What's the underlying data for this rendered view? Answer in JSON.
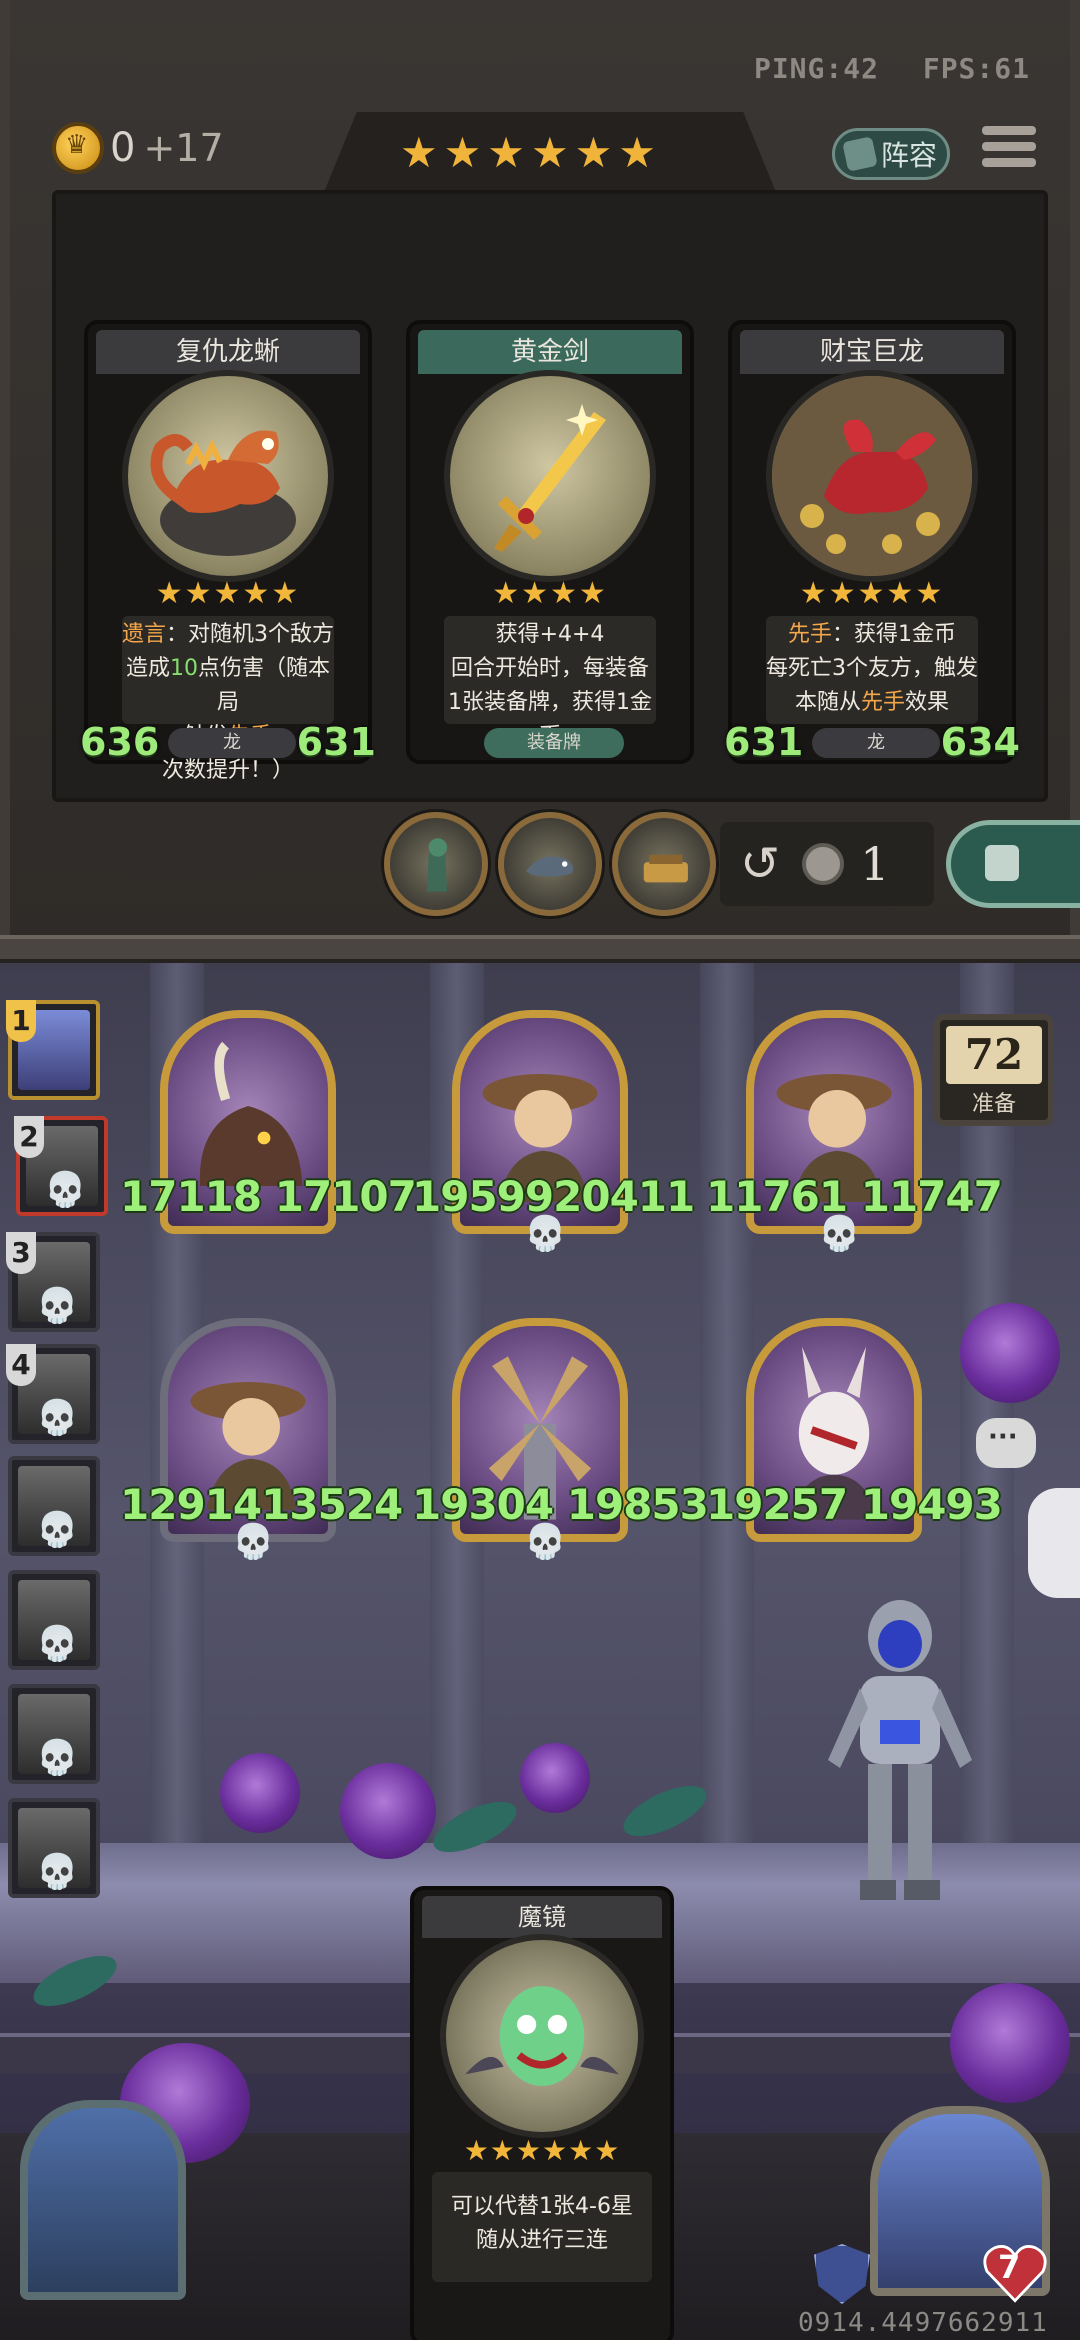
{
  "hud": {
    "ping": "PING:42",
    "fps": "FPS:61"
  },
  "gold": {
    "amount": "0",
    "income": "+17"
  },
  "tavern": {
    "stars": "★★★★★★"
  },
  "lineup_button": {
    "label": "阵容"
  },
  "shop_cards": [
    {
      "name": "复仇龙蜥",
      "stars": "★★★★★",
      "text_parts": [
        {
          "t": "遗言",
          "c": "orange"
        },
        {
          "t": "：对随机3个敌方\n造成",
          "c": ""
        },
        {
          "t": "10",
          "c": "green"
        },
        {
          "t": "点伤害（随本局\n触发",
          "c": ""
        },
        {
          "t": "先手",
          "c": "orange"
        },
        {
          "t": "次数提升！）",
          "c": ""
        }
      ],
      "attack": "636",
      "health": "631",
      "tribe": "龙"
    },
    {
      "name": "黄金剑",
      "stars": "★★★★",
      "text_parts": [
        {
          "t": "获得+4+4\n回合开始时，每装备\n1张装备牌，获得1金币",
          "c": ""
        }
      ],
      "tribe": "装备牌"
    },
    {
      "name": "财宝巨龙",
      "stars": "★★★★★",
      "text_parts": [
        {
          "t": "先手",
          "c": "orange"
        },
        {
          "t": "：获得1金币\n每死亡3个友方，触发\n本随从",
          "c": ""
        },
        {
          "t": "先手",
          "c": "orange"
        },
        {
          "t": "效果",
          "c": ""
        }
      ],
      "attack": "631",
      "health": "634",
      "tribe": "龙"
    }
  ],
  "refresh": {
    "cost": "1"
  },
  "opponents": [
    {
      "rank": "1"
    },
    {
      "rank": "2"
    },
    {
      "rank": "3"
    },
    {
      "rank": "4"
    },
    {
      "rank": ""
    },
    {
      "rank": ""
    },
    {
      "rank": ""
    },
    {
      "rank": ""
    }
  ],
  "board_minions": [
    {
      "attack": "17118",
      "health": "17107",
      "portrait": "boar"
    },
    {
      "attack": "19599",
      "health": "20411",
      "portrait": "cowboy"
    },
    {
      "attack": "11761",
      "health": "11747",
      "portrait": "cowboy"
    },
    {
      "attack": "12914",
      "health": "13524",
      "portrait": "cowboy"
    },
    {
      "attack": "19304",
      "health": "19853",
      "portrait": "windmill"
    },
    {
      "attack": "19257",
      "health": "19493",
      "portrait": "masked-rabbit"
    }
  ],
  "prepare": {
    "count": "72",
    "label": "准备"
  },
  "hand_card": {
    "name": "魔镜",
    "stars": "★★★★★★",
    "text": "可以代替1张4-6星\n随从进行三连"
  },
  "hero": {
    "health": "7"
  },
  "build_id": "0914.4497662911 8",
  "colors": {
    "star": "#f1b63a",
    "stat_green": "#9ff07a",
    "keyword_orange": "#f4a64a",
    "frame_gold": "#c79a3b"
  }
}
